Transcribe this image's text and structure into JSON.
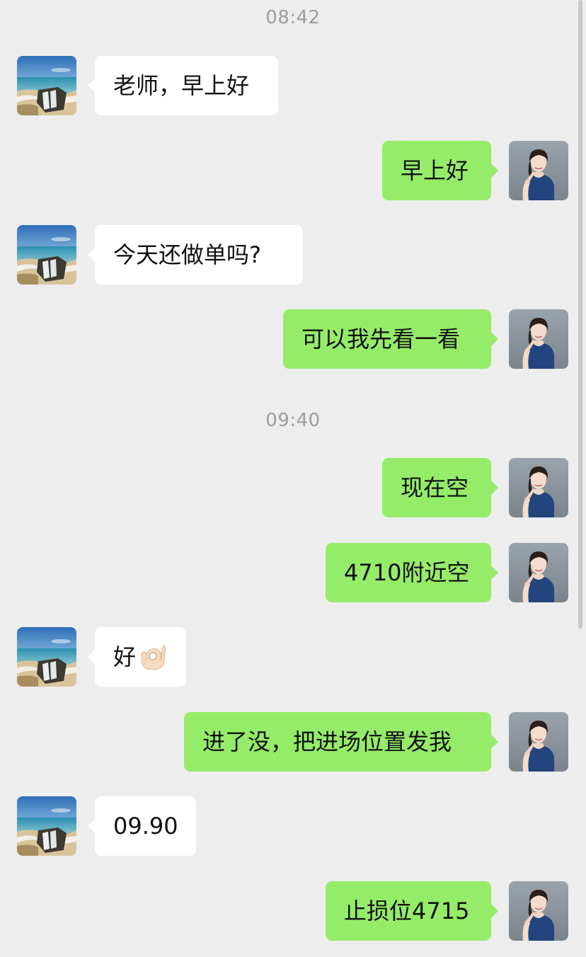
{
  "timestamps": [
    "08:42",
    "09:40"
  ],
  "messages": [
    {
      "side": "in",
      "text": "老师，早上好"
    },
    {
      "side": "out",
      "text": "早上好"
    },
    {
      "side": "in",
      "text": "今天还做单吗?"
    },
    {
      "side": "out",
      "text": "可以我先看一看"
    },
    {
      "side": "out",
      "text": "现在空"
    },
    {
      "side": "out",
      "text": "4710附近空"
    },
    {
      "side": "in",
      "text": "好",
      "emoji": "ok-hand"
    },
    {
      "side": "out",
      "text": "进了没，把进场位置发我"
    },
    {
      "side": "in",
      "text": "09.90"
    },
    {
      "side": "out",
      "text": "止损位4715"
    }
  ],
  "colors": {
    "background": "#ededed",
    "incoming_bubble": "#ffffff",
    "outgoing_bubble": "#95ec69",
    "timestamp_text": "#9d9d9d"
  }
}
